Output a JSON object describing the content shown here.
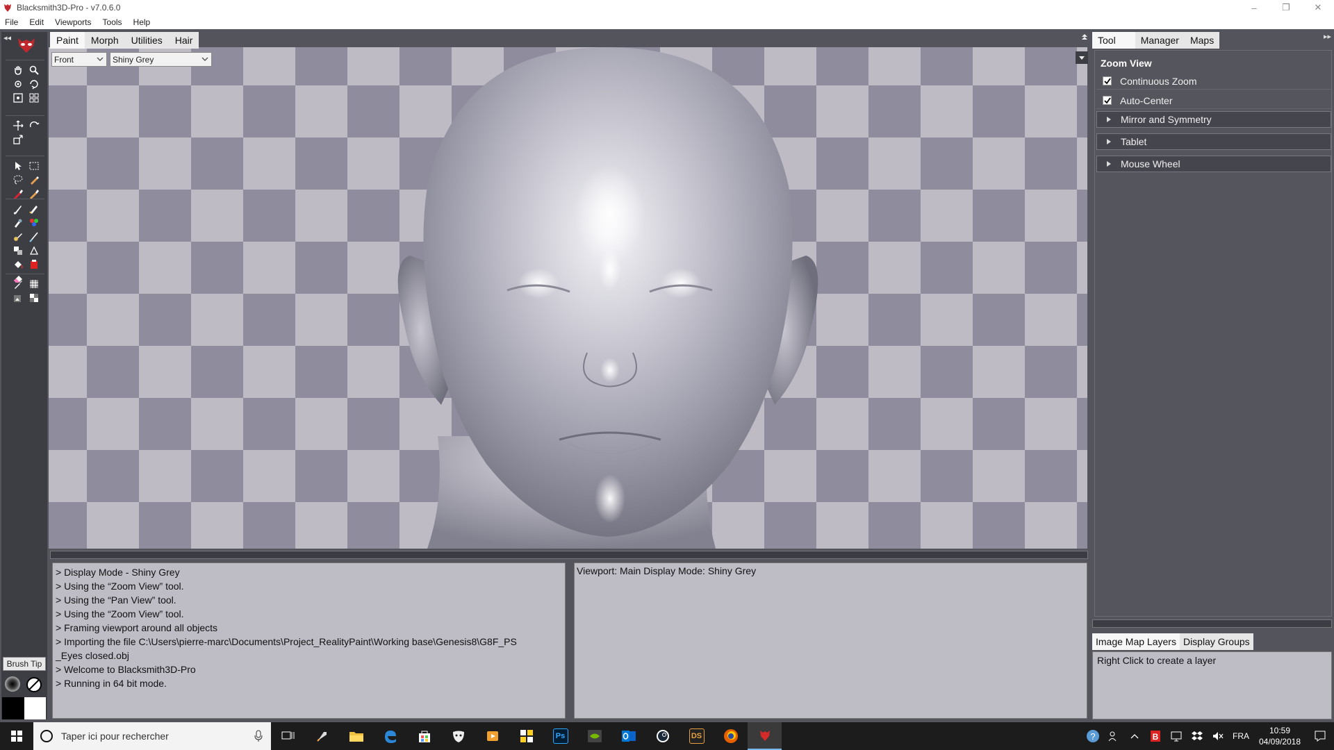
{
  "window": {
    "title": "Blacksmith3D-Pro - v7.0.6.0",
    "controls": {
      "minimize": "–",
      "restore": "❐",
      "close": "✕"
    }
  },
  "menu": [
    "File",
    "Edit",
    "Viewports",
    "Tools",
    "Help"
  ],
  "left_toolbar": {
    "collapse": "◂◂",
    "brush_tip_label": "Brush Tip"
  },
  "top_tabs": [
    {
      "label": "Paint",
      "active": true
    },
    {
      "label": "Morph",
      "active": false
    },
    {
      "label": "Utilities",
      "active": false
    },
    {
      "label": "Hair",
      "active": false
    }
  ],
  "viewport": {
    "view_select": "Front",
    "display_mode_select": "Shiny Grey"
  },
  "log": [
    "> Display Mode - Shiny Grey",
    "> Using the “Zoom View” tool.",
    "> Using the “Pan View” tool.",
    "> Using the “Zoom View” tool.",
    "> Framing viewport around all objects",
    "> Importing the file C:\\Users\\pierre-marc\\Documents\\Project_RealityPaint\\Working base\\Genesis8\\G8F_PS",
    "_Eyes closed.obj",
    "> Welcome to Blacksmith3D-Pro",
    "> Running in 64 bit mode."
  ],
  "status": "Viewport: Main Display Mode: Shiny Grey",
  "right_panel": {
    "collapse": "▸▸",
    "tabs": [
      {
        "label": "Tool",
        "active": true
      },
      {
        "label": "Manager",
        "active": false
      },
      {
        "label": "Maps",
        "active": false
      }
    ],
    "section_title": "Zoom View",
    "options": [
      {
        "label": "Continuous Zoom",
        "checked": true
      },
      {
        "label": "Auto-Center",
        "checked": true
      }
    ],
    "groups": [
      "Mirror and Symmetry",
      "Tablet",
      "Mouse Wheel"
    ],
    "bottom_tabs": [
      {
        "label": "Image Map Layers",
        "active": true
      },
      {
        "label": "Display Groups",
        "active": false
      }
    ],
    "layers_hint": "Right Click to create a layer"
  },
  "taskbar": {
    "search_placeholder": "Taper ici pour rechercher",
    "photoshop": "Ps",
    "daz": "DS",
    "language": "FRA",
    "time": "10:59",
    "date": "04/09/2018"
  }
}
